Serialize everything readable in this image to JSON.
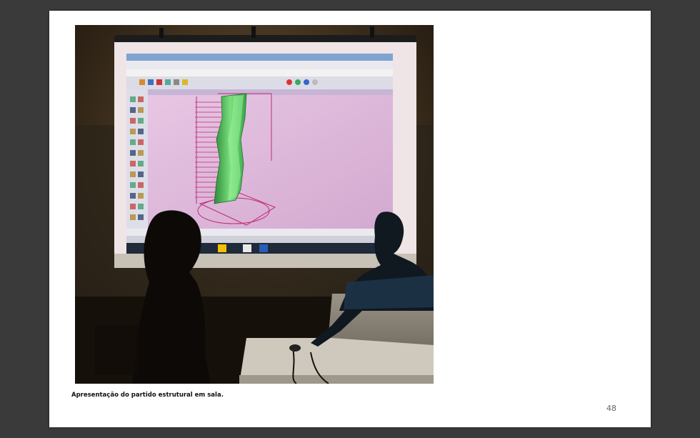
{
  "document": {
    "caption": "Apresentação do partido estrutural em sala.",
    "page_number": "48"
  },
  "photo": {
    "subject": "classroom-presentation-3d-model",
    "colors": {
      "wall": "#3b2d1c",
      "screen": "#d8b2d6",
      "model": "#5fcf6a",
      "guides": "#c02a7a"
    }
  }
}
